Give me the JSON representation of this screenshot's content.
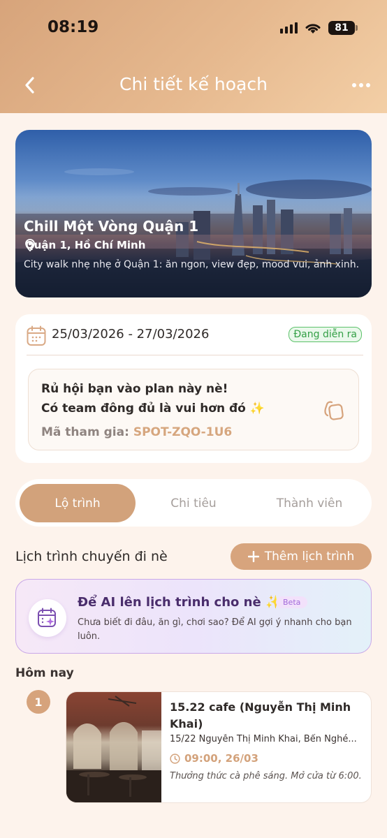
{
  "status_bar": {
    "time": "08:19",
    "battery": "81"
  },
  "header": {
    "title": "Chi tiết kế hoạch"
  },
  "hero": {
    "title": "Chill Một Vòng Quận 1",
    "location": "Quận 1, Hồ Chí Minh",
    "description": "City walk nhẹ nhẹ ở Quận 1: ăn ngon, view đẹp, mood vui, ảnh xinh."
  },
  "plan_info": {
    "date_range": "25/03/2026 - 27/03/2026",
    "status": "Đang diễn ra",
    "invite_line1": "Rủ hội bạn vào plan này nè!",
    "invite_line2": "Có team đông đủ là vui hơn đó",
    "sparkle": "✨",
    "join_code_label": "Mã tham gia:",
    "join_code": "SPOT-ZQO-1U6"
  },
  "tabs": [
    {
      "label": "Lộ trình",
      "active": true
    },
    {
      "label": "Chi tiêu",
      "active": false
    },
    {
      "label": "Thành viên",
      "active": false
    }
  ],
  "itinerary": {
    "section_title": "Lịch trình chuyến đi nè",
    "add_button": "Thêm lịch trình",
    "ai_title": "Để AI lên lịch trình cho nè",
    "ai_sparkle": "✨",
    "ai_badge": "Beta",
    "ai_description": "Chưa biết đi đâu, ăn gì, chơi sao? Để AI gợi ý nhanh cho bạn luôn.",
    "day_label": "Hôm nay",
    "items": [
      {
        "index": "1",
        "name": "15.22 cafe (Nguyễn Thị Minh Khai)",
        "address": "15/22 Nguyễn Thị Minh Khai, Bến Nghé...",
        "time": "09:00, 26/03",
        "note": "Thưởng thức cà phê sáng. Mở cửa từ 6:00."
      }
    ]
  },
  "colors": {
    "accent": "#d2a27b",
    "status_green": "#35a047",
    "ai_purple": "#4a2d6c"
  }
}
